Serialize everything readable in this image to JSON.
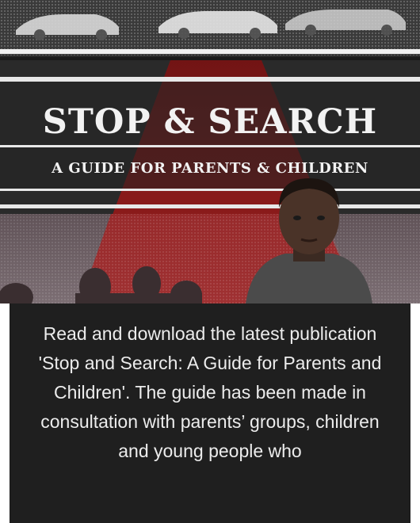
{
  "banner": {
    "title": "STOP & SEARCH",
    "subtitle": "A GUIDE FOR PARENTS & CHILDREN"
  },
  "description": {
    "text": "Read and download the latest publication 'Stop and Search: A Guide for Parents and Children'. The guide has been made in consultation with parents’ groups, children and young people who"
  },
  "colors": {
    "accent_red": "#8c1c1c",
    "background_dark": "#1f1f1f",
    "text_light": "#ececec"
  }
}
